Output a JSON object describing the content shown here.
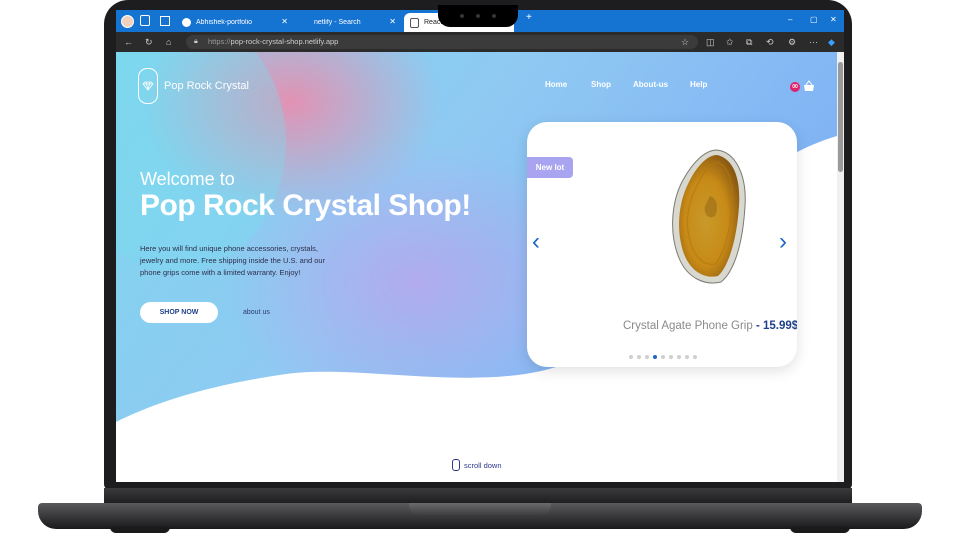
{
  "browser": {
    "tabs": [
      {
        "label": "Abhishek-portfolio",
        "icon": "github-icon",
        "active": false
      },
      {
        "label": "netlify - Search",
        "icon": "search-icon",
        "active": false
      },
      {
        "label": "React A",
        "icon": "page-icon",
        "active": true
      }
    ],
    "new_tab": "+",
    "window_controls": {
      "minimize": "–",
      "maximize": "▢",
      "close": "✕"
    },
    "url_prefix": "https://",
    "url_host": "pop-rock-crystal-shop.netlify.app"
  },
  "site": {
    "logo_text": "Pop Rock Crystal",
    "nav": [
      "Home",
      "Shop",
      "About-us",
      "Help"
    ],
    "cart_count": "00"
  },
  "hero": {
    "welcome": "Welcome to",
    "headline": "Pop Rock Crystal Shop!",
    "description": "Here you will find unique phone accessories, crystals, jewelry and more. Free shipping inside the U.S. and our phone grips come with a limited warranty. Enjoy!",
    "shop_button": "SHOP NOW",
    "about_link": "about us"
  },
  "carousel": {
    "badge": "New lot",
    "product_name": "Crystal Agate Phone Grip",
    "separator": " - ",
    "price": "15.99$",
    "slide_count": 9,
    "active_slide": 4
  },
  "footer": {
    "scroll_label": "scroll down"
  },
  "colors": {
    "tab_bar": "#1573d2",
    "accent": "#1e67c8",
    "badge": "#a8a4f0",
    "cart_badge": "#e0226b"
  }
}
